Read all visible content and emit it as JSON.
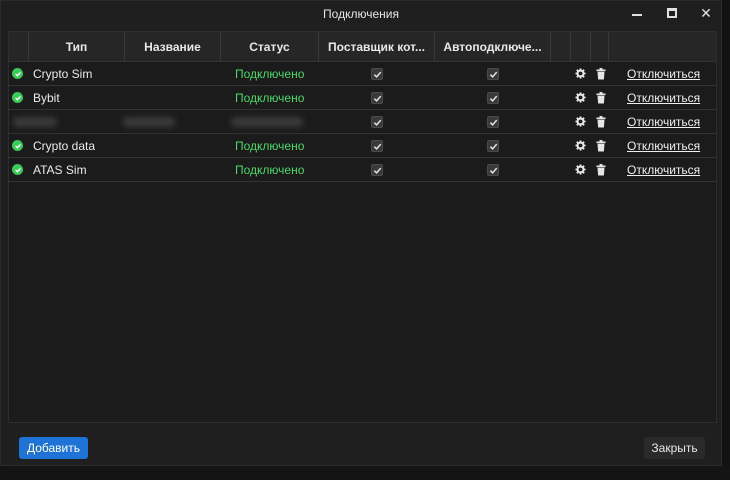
{
  "window": {
    "title": "Подключения"
  },
  "columns": [
    "Тип",
    "Название",
    "Статус",
    "Поставщик кот...",
    "Автоподключе..."
  ],
  "rows": [
    {
      "type": "Crypto Sim",
      "name": "",
      "status": "Подключено",
      "provider": true,
      "autoconnect": true,
      "action": "Отключиться",
      "blurred": false
    },
    {
      "type": "Bybit",
      "name": "",
      "status": "Подключено",
      "provider": true,
      "autoconnect": true,
      "action": "Отключиться",
      "blurred": false
    },
    {
      "type": "",
      "name": "",
      "status": "",
      "provider": true,
      "autoconnect": true,
      "action": "Отключиться",
      "blurred": true
    },
    {
      "type": "Crypto data",
      "name": "",
      "status": "Подключено",
      "provider": true,
      "autoconnect": true,
      "action": "Отключиться",
      "blurred": false
    },
    {
      "type": "ATAS Sim",
      "name": "",
      "status": "Подключено",
      "provider": true,
      "autoconnect": true,
      "action": "Отключиться",
      "blurred": false
    }
  ],
  "buttons": {
    "add": "Добавить",
    "close": "Закрыть"
  },
  "colors": {
    "accent": "#1f72d6",
    "status_ok": "#4cd86a",
    "ok_icon": "#3cc95a"
  },
  "icons": {
    "status": "check-circle-icon",
    "settings": "gear-icon",
    "delete": "trash-icon"
  }
}
